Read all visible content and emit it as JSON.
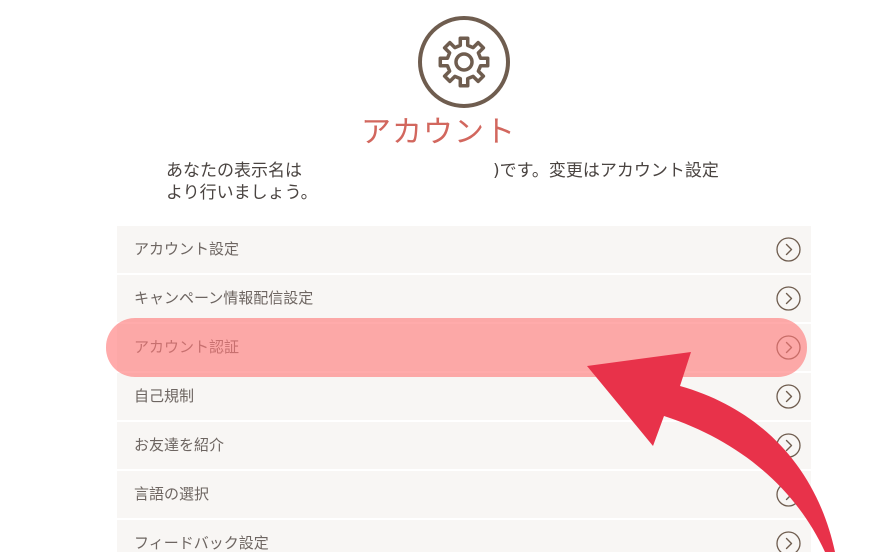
{
  "header": {
    "icon": "gear-icon",
    "title": "アカウント"
  },
  "intro": {
    "prefix": "あなたの表示名は",
    "suffix_line1": ")です。変更はアカウント設定",
    "line2": "より行いましょう。"
  },
  "menu": {
    "items": [
      {
        "label": "アカウント設定",
        "icon": "chevron-right-circle-icon"
      },
      {
        "label": "キャンペーン情報配信設定",
        "icon": "chevron-right-circle-icon"
      },
      {
        "label": "アカウント認証",
        "icon": "chevron-right-circle-icon",
        "highlighted": true
      },
      {
        "label": "自己規制",
        "icon": "chevron-right-circle-icon"
      },
      {
        "label": "お友達を紹介",
        "icon": "chevron-right-circle-icon"
      },
      {
        "label": "言語の選択",
        "icon": "chevron-right-circle-icon"
      },
      {
        "label": "フィードバック設定",
        "icon": "chevron-right-circle-icon"
      }
    ]
  },
  "annotation": {
    "highlight_color": "#ff7878",
    "arrow_color": "#e8324a"
  },
  "colors": {
    "title": "#d2675e",
    "icon_brown": "#6f5d4f",
    "row_bg": "#f8f6f4",
    "row_text": "#6d6561"
  }
}
